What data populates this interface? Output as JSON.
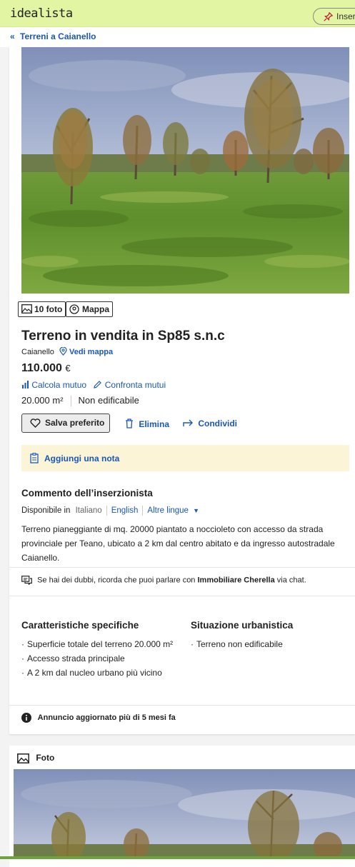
{
  "header": {
    "logo": "idealista",
    "insert_button": "Inser"
  },
  "breadcrumb": {
    "label": "Terreni a Caianello"
  },
  "media": {
    "photos_label": "10 foto",
    "map_label": "Mappa"
  },
  "listing": {
    "title": "Terreno in vendita in Sp85 s.n.c",
    "location": "Caianello",
    "map_link": "Vedi mappa",
    "price": "110.000",
    "currency": "€",
    "calc_mortgage": "Calcola mutuo",
    "compare_mortgages": "Confronta mutui",
    "surface": "20.000 m²",
    "buildable": "Non edificabile"
  },
  "actions": {
    "save": "Salva preferito",
    "delete": "Elimina",
    "share": "Condividi",
    "add_note": "Aggiungi una nota"
  },
  "comment": {
    "heading": "Commento dell’inserzionista",
    "available_in": "Disponibile in",
    "current_lang": "Italiano",
    "english": "English",
    "other_langs": "Altre lingue",
    "description": "Terreno pianeggiante di mq. 20000 piantato a noccioleto con accesso da strada provinciale per Teano, ubicato a 2 km dal centro abitato e da ingresso autostradale Caianello."
  },
  "chat": {
    "prefix": "Se hai dei dubbi, ricorda che puoi parlare con",
    "agency": "Immobiliare Cherella",
    "suffix": "via chat."
  },
  "features": {
    "specific_heading": "Caratteristiche specifiche",
    "specific_items": [
      "Superficie totale del terreno 20.000 m²",
      "Accesso strada principale",
      "A 2 km dal nucleo urbano più vicino"
    ],
    "urban_heading": "Situazione urbanistica",
    "urban_items": [
      "Terreno non edificabile"
    ]
  },
  "updated": "Annuncio aggiornato più di 5 mesi fa",
  "gallery": {
    "heading": "Foto"
  },
  "colors": {
    "brand_bar": "#e1f5a3",
    "link": "#1a57b8",
    "note_bg": "#fbf4d6",
    "grass": "#5e8f2c"
  },
  "icons": [
    "pin-icon",
    "double-chevron-left-icon",
    "photo-icon",
    "location-icon",
    "chart-icon",
    "pencil-icon",
    "heart-icon",
    "trash-icon",
    "share-icon",
    "note-icon",
    "chat-icon",
    "info-icon",
    "image-icon",
    "caret-down-icon"
  ]
}
